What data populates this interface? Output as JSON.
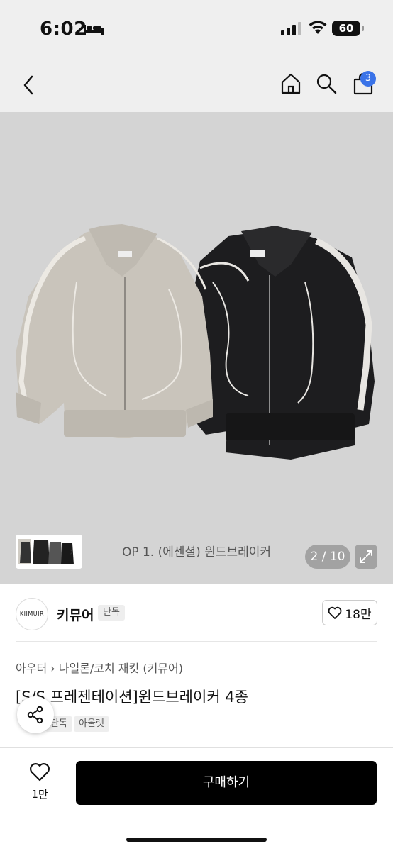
{
  "status_bar": {
    "time": "6:02",
    "battery": "60"
  },
  "header": {
    "cart_count": "3"
  },
  "gallery": {
    "caption": "OP 1. (에센셜) 윈드브레이커",
    "counter": "2 / 10"
  },
  "brand": {
    "logo_text": "KIIMUIR",
    "name": "키뮤어",
    "exclusive_tag": "단독",
    "like_count": "18만"
  },
  "product": {
    "breadcrumb": "아우터  ›  나일론/코치 재킷 (키뮤어)",
    "title": "[S/S 프레젠테이션]윈드브레이커 4종",
    "tags": [
      "단독",
      "아울렛"
    ]
  },
  "bottom_bar": {
    "like_count": "1만",
    "buy_label": "구매하기"
  },
  "colors": {
    "buy_button": "#000000",
    "badge": "#3a73e8",
    "jacket_beige": "#c9c4bb",
    "jacket_black": "#1d1d1f"
  }
}
